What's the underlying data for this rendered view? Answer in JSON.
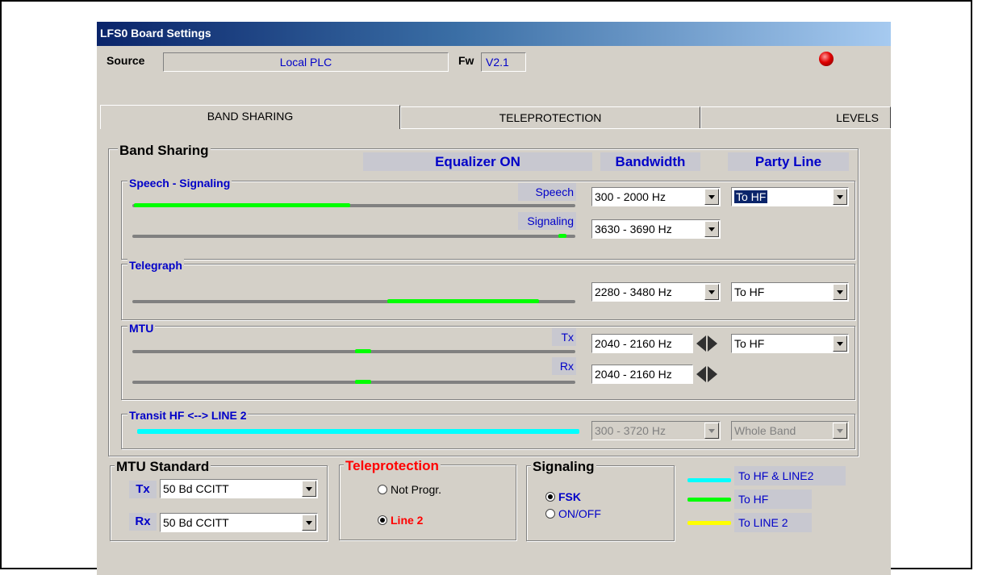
{
  "window": {
    "title": "LFS0 Board Settings"
  },
  "source": {
    "label": "Source",
    "value": "Local PLC",
    "fw_label": "Fw",
    "fw_value": "V2.1"
  },
  "tabs": [
    {
      "label": "BAND SHARING",
      "active": true
    },
    {
      "label": "TELEPROTECTION",
      "active": false
    },
    {
      "label": "LEVELS",
      "active": false
    }
  ],
  "band_sharing": {
    "title": "Band Sharing",
    "headers": {
      "equalizer": "Equalizer ON",
      "bandwidth": "Bandwidth",
      "party_line": "Party Line"
    },
    "speech_signaling": {
      "title": "Speech - Signaling",
      "speech_label": "Speech",
      "signaling_label": "Signaling",
      "speech_bandwidth": "300 - 2000 Hz",
      "signaling_bandwidth": "3630 - 3690 Hz",
      "party_line": "To HF"
    },
    "telegraph": {
      "title": "Telegraph",
      "bandwidth": "2280 - 3480 Hz",
      "party_line": "To HF"
    },
    "mtu": {
      "title": "MTU",
      "tx_label": "Tx",
      "rx_label": "Rx",
      "tx_bandwidth": "2040 - 2160 Hz",
      "rx_bandwidth": "2040 - 2160 Hz",
      "party_line": "To HF"
    },
    "transit": {
      "title": "Transit HF <--> LINE 2",
      "bandwidth": "300 - 3720 Hz",
      "party_line": "Whole Band"
    }
  },
  "mtu_standard": {
    "title": "MTU Standard",
    "tx_label": "Tx",
    "tx_value": "50 Bd CCITT",
    "rx_label": "Rx",
    "rx_value": "50 Bd CCITT"
  },
  "teleprotection": {
    "title": "Teleprotection",
    "options": [
      "Not Progr.",
      "Line 2"
    ],
    "selected": "Line 2"
  },
  "signaling": {
    "title": "Signaling",
    "options": [
      "FSK",
      "ON/OFF"
    ],
    "selected": "FSK"
  },
  "legend": [
    {
      "label": "To HF & LINE2",
      "color": "#00ffff"
    },
    {
      "label": "To HF",
      "color": "#00ff00"
    },
    {
      "label": "To LINE 2",
      "color": "#ffff00"
    }
  ],
  "colors": {
    "to_hf": "#00ff00",
    "transit": "#00ffff",
    "title_red": "#ff0000",
    "label_blue": "#0000c8"
  }
}
